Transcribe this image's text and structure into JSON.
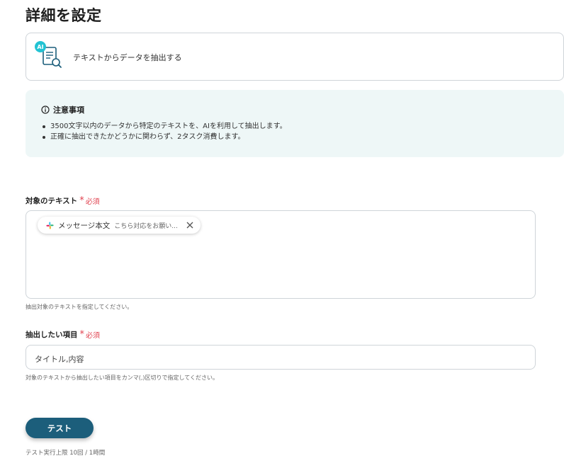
{
  "page": {
    "title": "詳細を設定"
  },
  "action": {
    "ai_badge": "AI",
    "label": "テキストからデータを抽出する"
  },
  "notice": {
    "heading": "注意事項",
    "items": [
      "3500文字以内のデータから特定のテキストを、AIを利用して抽出します。",
      "正確に抽出できたかどうかに関わらず、2タスク消費します。"
    ]
  },
  "target_text": {
    "label": "対象のテキスト",
    "required": "必須",
    "chip_main": "メッセージ本文",
    "chip_sub": "こちら対応をお願い...",
    "help": "抽出対象のテキストを指定してください。"
  },
  "extract_items": {
    "label": "抽出したい項目",
    "required": "必須",
    "value": "タイトル,内容",
    "help": "対象のテキストから抽出したい項目をカンマ(,)区切りで指定してください。"
  },
  "test": {
    "button_label": "テスト",
    "limit_text": "テスト実行上限 10回 / 1時間"
  },
  "colors": {
    "accent": "#1c5e7b",
    "required": "#e0424f",
    "notice_bg": "#eef7f7",
    "ai_badge": "#22c3d3"
  },
  "icons": {
    "action": "document-search-icon",
    "notice": "info-icon",
    "chip_app": "slack-icon",
    "chip_close": "close-icon"
  }
}
